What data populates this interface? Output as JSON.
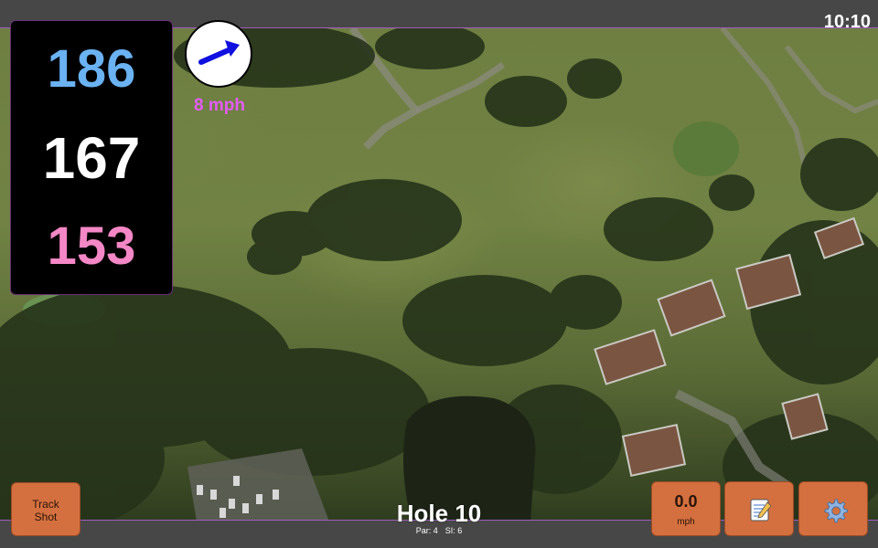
{
  "status": {
    "time": "10:10"
  },
  "distances": {
    "back": "186",
    "middle": "167",
    "front": "153"
  },
  "wind": {
    "speed": "8 mph",
    "icon": "wind-direction-arrow-icon"
  },
  "hole": {
    "title": "Hole 10",
    "par": "Par: 4",
    "stroke_index": "SI: 6"
  },
  "buttons": {
    "track_shot": "Track\nShot",
    "speed_value": "0.0",
    "speed_unit": "mph",
    "notes_icon": "notepad-icon",
    "settings_icon": "gear-icon"
  },
  "colors": {
    "back": "#6ab2f2",
    "middle": "#ffffff",
    "front": "#f487c6",
    "wind_text": "#e35df4",
    "button": "#d4703f",
    "arrow": "#1010e0"
  }
}
